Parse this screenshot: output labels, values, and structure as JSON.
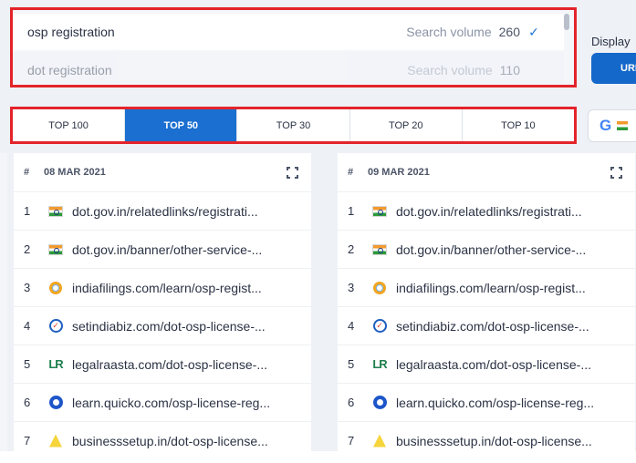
{
  "keyword_dropdown": {
    "items": [
      {
        "keyword": "osp registration",
        "volume_label": "Search volume",
        "volume": "260",
        "selected": true
      },
      {
        "keyword": "dot registration",
        "volume_label": "Search volume",
        "volume": "110",
        "selected": false
      }
    ]
  },
  "display_label": "Display",
  "url_button_label": "URL",
  "tabs": [
    {
      "label": "TOP 100",
      "active": false
    },
    {
      "label": "TOP 50",
      "active": true
    },
    {
      "label": "TOP 30",
      "active": false
    },
    {
      "label": "TOP 20",
      "active": false
    },
    {
      "label": "TOP 10",
      "active": false
    }
  ],
  "engine": {
    "icon": "google-icon",
    "letter": "G"
  },
  "columns": [
    {
      "hash": "#",
      "date": "08 MAR 2021",
      "rows": [
        {
          "pos": "1",
          "icon": "india-flag-icon",
          "url": "dot.gov.in/relatedlinks/registrati..."
        },
        {
          "pos": "2",
          "icon": "india-flag-icon",
          "url": "dot.gov.in/banner/other-service-..."
        },
        {
          "pos": "3",
          "icon": "indiafilings-icon",
          "url": "indiafilings.com/learn/osp-regist..."
        },
        {
          "pos": "4",
          "icon": "setindiabiz-icon",
          "url": "setindiabiz.com/dot-osp-license-..."
        },
        {
          "pos": "5",
          "icon": "legalraasta-icon",
          "url": "legalraasta.com/dot-osp-license-..."
        },
        {
          "pos": "6",
          "icon": "quicko-icon",
          "url": "learn.quicko.com/osp-license-reg..."
        },
        {
          "pos": "7",
          "icon": "businesssetup-icon",
          "url": "businesssetup.in/dot-osp-license..."
        }
      ]
    },
    {
      "hash": "#",
      "date": "09 MAR 2021",
      "rows": [
        {
          "pos": "1",
          "icon": "india-flag-icon",
          "url": "dot.gov.in/relatedlinks/registrati..."
        },
        {
          "pos": "2",
          "icon": "india-flag-icon",
          "url": "dot.gov.in/banner/other-service-..."
        },
        {
          "pos": "3",
          "icon": "indiafilings-icon",
          "url": "indiafilings.com/learn/osp-regist..."
        },
        {
          "pos": "4",
          "icon": "setindiabiz-icon",
          "url": "setindiabiz.com/dot-osp-license-..."
        },
        {
          "pos": "5",
          "icon": "legalraasta-icon",
          "url": "legalraasta.com/dot-osp-license-..."
        },
        {
          "pos": "6",
          "icon": "quicko-icon",
          "url": "learn.quicko.com/osp-license-reg..."
        },
        {
          "pos": "7",
          "icon": "businesssetup-icon",
          "url": "businesssetup.in/dot-osp-license..."
        }
      ]
    }
  ],
  "colors": {
    "accent": "#1a6fd0",
    "highlight_border": "#e3242b"
  }
}
